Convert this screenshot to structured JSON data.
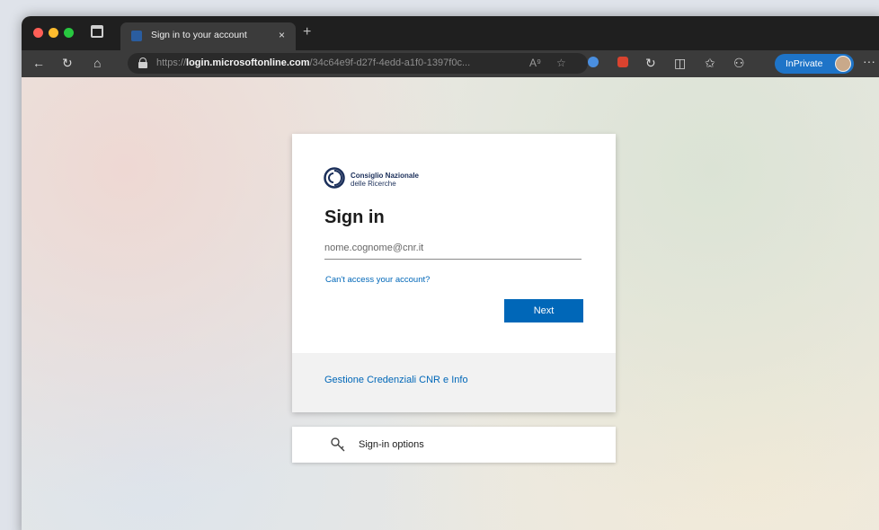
{
  "browser": {
    "tab": {
      "title": "Sign in to your account",
      "close": "×"
    },
    "new_tab": "+",
    "address": {
      "scheme": "https://",
      "host": "login.microsoftonline.com",
      "path": "/34c64e9f-d27f-4edd-a1f0-1397f0c..."
    },
    "inprivate_label": "InPrivate",
    "more": "···",
    "colors": {
      "inprivate": "#1e74c8",
      "tab_bar": "#1f1f1f"
    }
  },
  "login": {
    "logo_line1": "Consiglio Nazionale",
    "logo_line2": "delle Ricerche",
    "title": "Sign in",
    "email_placeholder": "nome.cognome@cnr.it",
    "cant_access": "Can't access your account?",
    "next": "Next",
    "footer_link": "Gestione Credenziali CNR e Info",
    "colors": {
      "accent": "#0067b8"
    }
  },
  "signin_options": {
    "label": "Sign-in options",
    "icon": "key-icon"
  }
}
